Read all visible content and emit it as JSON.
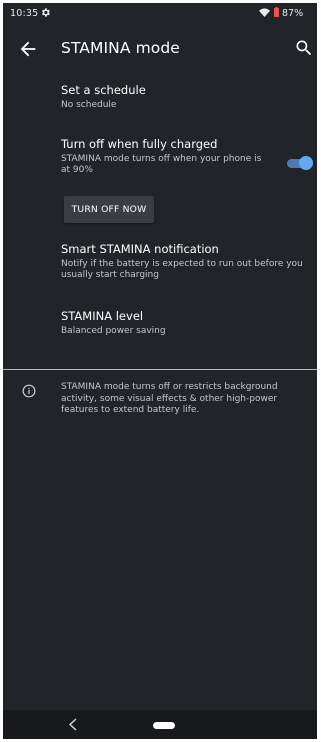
{
  "status_bar": {
    "time": "10:35",
    "battery_percent": "87%",
    "icons": [
      "gear-icon",
      "wifi-icon",
      "battery-icon"
    ]
  },
  "app_bar": {
    "title": "STAMINA mode",
    "back_icon": "arrow-left-icon",
    "search_icon": "search-icon"
  },
  "settings": {
    "schedule": {
      "title": "Set a schedule",
      "summary": "No schedule"
    },
    "turn_off_charged": {
      "title": "Turn off when fully charged",
      "summary": "STAMINA mode turns off when your phone is at 90%",
      "toggle_on": true
    },
    "turn_off_now_label": "TURN OFF NOW",
    "smart_notification": {
      "title": "Smart STAMINA notification",
      "summary": "Notify if the battery is expected to run out before you usually start charging"
    },
    "stamina_level": {
      "title": "STAMINA level",
      "summary": "Balanced power saving"
    }
  },
  "info": {
    "icon": "info-icon",
    "text": "STAMINA mode turns off or restricts background activity, some visual effects & other high-power features to extend battery life."
  },
  "nav_bar": {
    "icons": [
      "nav-back-icon",
      "nav-home-pill"
    ]
  },
  "colors": {
    "background": "#212529",
    "accent": "#64a8f5",
    "button": "#3a3e43",
    "nav_bar": "#17191c"
  }
}
